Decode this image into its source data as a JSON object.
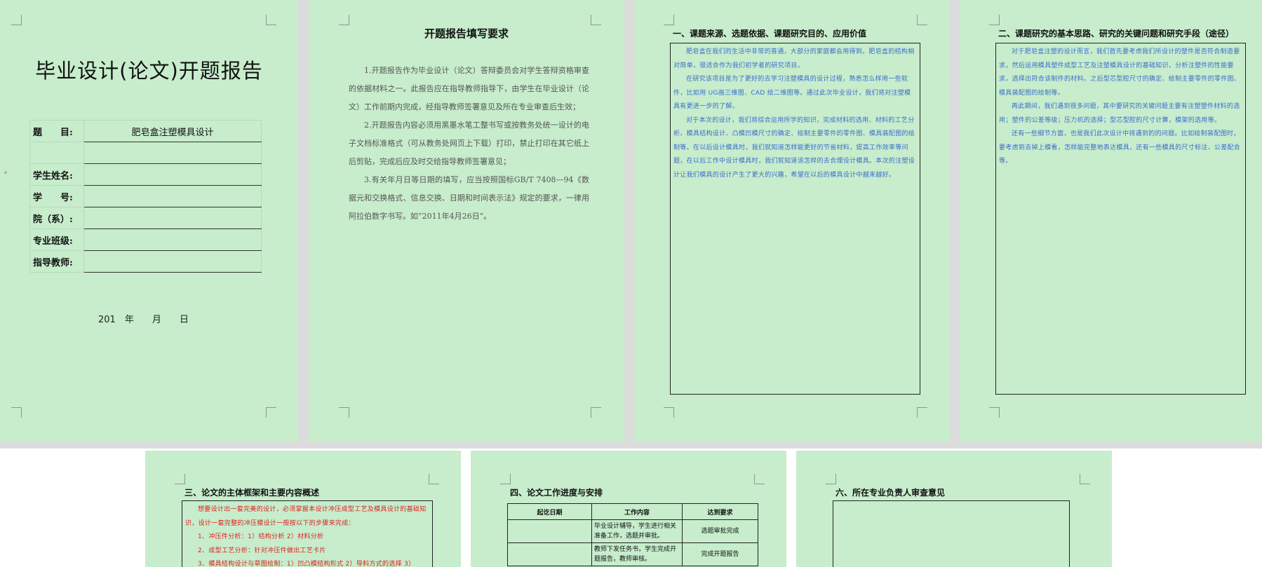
{
  "cover": {
    "title": "毕业设计(论文)开题报告",
    "fields": [
      {
        "label": "题　　目:",
        "value": "肥皂盒注塑模具设计"
      },
      {
        "label": "",
        "value": ""
      },
      {
        "label": "学生姓名:",
        "value": ""
      },
      {
        "label": "学　　号:",
        "value": ""
      },
      {
        "label": "院（系）:",
        "value": ""
      },
      {
        "label": "专业班级:",
        "value": ""
      },
      {
        "label": "指导教师:",
        "value": ""
      }
    ],
    "date": "201　年　　月　　日"
  },
  "requirements": {
    "title": "开题报告填写要求",
    "paragraphs": [
      "1.开题报告作为毕业设计（论文）答辩委员会对学生答辩资格审查的依据材料之一。此报告应在指导教师指导下，由学生在毕业设计（论文）工作前期内完成，经指导教师签署意见及所在专业审查后生效；",
      "2.开题报告内容必须用黑墨水笔工整书写或按教务处统一设计的电子文档标准格式（可从教务处网页上下载）打印，禁止打印在其它纸上后剪贴，完成后应及时交给指导教师签署意见；",
      "3.有关年月日等日期的填写，应当按照国标GB/T 7408—94《数据元和交换格式、信息交换、日期和时间表示法》规定的要求，一律用阿拉伯数字书写。如“2011年4月26日”。"
    ]
  },
  "section1": {
    "heading": "一、课题来源、选题依据、课题研究目的、应用价值",
    "paragraphs": [
      "肥皂盒在我们的生活中非常的普通，大部分的家庭都会用得到。肥皂盒的结构相对简单，很适合作为我们初学者的研究项目。",
      "在研究该项目是为了更好的去学习注塑模具的设计过程，熟悉怎么样用一些软件，比如用 UG画三维图、CAD 绘二维图等。通过此次毕业设计，我们将对注塑模具有更进一步的了解。",
      "对于本次的设计，我们将综合运用所学的知识，完成材料的选用、材料的工艺分析、模具结构设计、凸模凹模尺寸的确定、绘制主要零件的零件图、模具装配图的绘制等。在以后设计模具时，我们就知道怎样能更好的节省材料，提高工作效率等问题，在以后工作中设计模具时，我们就知道该怎样的去合理设计模具。本次的注塑设计让我们模具的设计产生了更大的兴趣，希望在以后的模具设计中越来越好。"
    ]
  },
  "section2": {
    "heading": "二、课题研究的基本思路、研究的关键问题和研究手段（途径）",
    "paragraphs": [
      "对于肥皂盒注塑的设计而言，我们首先要考虑我们所设计的塑件是否符合制造要求，然后运用模具塑件成型工艺及注塑模具设计的基础知识，分析注塑件的性能要求，选择出符合该制件的材料。之后型芯型腔尺寸的确定、绘制主要零件的零件图、模具装配图的绘制等。",
      "再此期间，我们遇到很多问题，其中要研究的关键问题主要有注塑塑件材料的选用；塑件的公差等级；压力机的选择；型芯型腔的尺寸计算，模架的选用等。",
      "还有一些细节方面，也是我们此次设计中将遇到的的问题。比如绘制装配图时，要考虑到去掉上模看，怎样能完整地表达模具，还有一些模具的尺寸标注、公差配合等。"
    ]
  },
  "section3": {
    "heading": "三、论文的主体框架和主要内容概述",
    "paragraphs": [
      "想要设计出一套完美的设计，必须掌握本设计冲压成型工艺及模具设计的基础知识，设计一套完整的冲压模设计一般按以下的步骤来完成：",
      "1、冲压件分析：1）结构分析 2）材料分析",
      "2、成型工艺分析：针对冲压件做出工艺卡片",
      "3、模具结构设计与草图绘制：1）凹凸模结构形式 2）导料方式的选择 3）"
    ]
  },
  "section4": {
    "heading": "四、论文工作进度与安排",
    "headers": [
      "起讫日期",
      "工作内容",
      "达到要求"
    ],
    "rows": [
      {
        "date": "",
        "work": "毕业设计辅导，学生进行相关准备工作，选题并审批。",
        "goal": "选题审批完成"
      },
      {
        "date": "",
        "work": "教师下发任务书，学生完成开题报告，教师审核。",
        "goal": "完成开题报告"
      }
    ]
  },
  "section6": {
    "heading": "六、所在专业负责人审查意见"
  }
}
